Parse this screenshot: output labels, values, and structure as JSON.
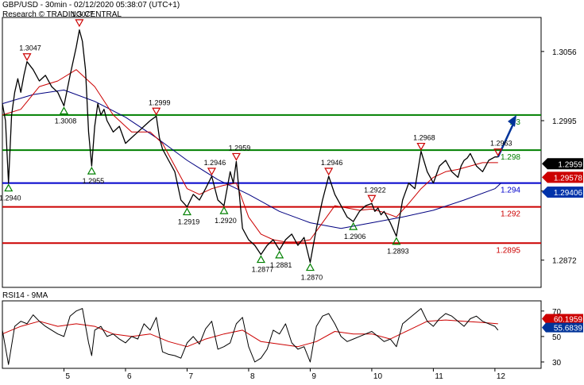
{
  "header": {
    "title_line": "GBP/USD - 30min - 02/12/2020 05:38:07 (UTC+1)",
    "subtitle_line": "Research © TRADING CENTRAL"
  },
  "colors": {
    "price": "#000000",
    "ma_fast": "#cc0000",
    "ma_slow": "#000080",
    "level_green": "#008000",
    "level_blue": "#0000cc",
    "level_red": "#cc0000",
    "arrow": "#003399",
    "marker_up": "#008000",
    "marker_down": "#cc0000",
    "rsi": "#000000",
    "rsi_ma": "#cc0000",
    "current_price_badge": "#000000",
    "ma_badge": "#cc0000",
    "pivot_badge": "#0033aa",
    "rsi_ma_badge": "#cc0000",
    "rsi_badge": "#003399"
  },
  "chart_data": {
    "type": "line",
    "title": "GBP/USD - 30min - 02/12/2020 05:38:07 (UTC+1)",
    "y_axis_ticks": [
      "1.3056",
      "1.2995",
      "1.2933",
      "1.2872"
    ],
    "x_axis_ticks": [
      "5",
      "6",
      "7",
      "8",
      "9",
      "10",
      "11",
      "12"
    ],
    "ylim": [
      1.2848,
      1.3086
    ],
    "x_range": [
      4.0,
      12.75
    ],
    "levels": [
      {
        "label": "1.3",
        "value": 1.3,
        "color_key": "level_green"
      },
      {
        "label": "1.298",
        "value": 1.2969,
        "color_key": "level_green"
      },
      {
        "label": "1.294",
        "value": 1.294,
        "color_key": "level_blue"
      },
      {
        "label": "1.292",
        "value": 1.2919,
        "color_key": "level_red"
      },
      {
        "label": "1.2895",
        "value": 1.2887,
        "color_key": "level_red"
      }
    ],
    "badges": [
      {
        "label": "1.2959",
        "value": 1.2957,
        "color_key": "current_price_badge"
      },
      {
        "label": "1.29578",
        "value": 1.2945,
        "color_key": "ma_badge"
      },
      {
        "label": "1.29406",
        "value": 1.2932,
        "color_key": "pivot_badge"
      }
    ],
    "price_series": {
      "name": "GBP/USD",
      "x": [
        4.0,
        4.05,
        4.1,
        4.15,
        4.2,
        4.25,
        4.3,
        4.35,
        4.4,
        4.5,
        4.6,
        4.7,
        4.8,
        4.9,
        5.0,
        5.1,
        5.2,
        5.25,
        5.3,
        5.35,
        5.4,
        5.45,
        5.5,
        5.55,
        5.6,
        5.65,
        5.7,
        5.8,
        5.9,
        6.0,
        6.1,
        6.2,
        6.3,
        6.4,
        6.5,
        6.55,
        6.6,
        6.7,
        6.8,
        6.9,
        7.0,
        7.1,
        7.2,
        7.3,
        7.4,
        7.5,
        7.6,
        7.65,
        7.7,
        7.75,
        7.8,
        7.9,
        8.0,
        8.1,
        8.2,
        8.3,
        8.4,
        8.5,
        8.6,
        8.7,
        8.8,
        8.9,
        9.0,
        9.1,
        9.2,
        9.3,
        9.4,
        9.5,
        9.6,
        9.7,
        9.8,
        9.9,
        10.0,
        10.05,
        10.1,
        10.15,
        10.2,
        10.3,
        10.4,
        10.5,
        10.6,
        10.7,
        10.8,
        10.9,
        11.0,
        11.1,
        11.2,
        11.3,
        11.4,
        11.45,
        11.5,
        11.55,
        11.6,
        11.7,
        11.8,
        11.9,
        12.0,
        12.05
      ],
      "values": [
        1.301,
        1.2995,
        1.294,
        1.3,
        1.302,
        1.3032,
        1.302,
        1.3035,
        1.3047,
        1.304,
        1.303,
        1.3035,
        1.3025,
        1.302,
        1.3008,
        1.3035,
        1.306,
        1.3075,
        1.3065,
        1.304,
        1.2985,
        1.2955,
        1.299,
        1.301,
        1.3,
        1.3005,
        1.2995,
        1.2985,
        1.299,
        1.2975,
        1.298,
        1.2985,
        1.299,
        1.2995,
        1.2999,
        1.298,
        1.297,
        1.296,
        1.295,
        1.2925,
        1.2919,
        1.293,
        1.2925,
        1.2935,
        1.2946,
        1.2925,
        1.292,
        1.2935,
        1.295,
        1.294,
        1.2959,
        1.29,
        1.289,
        1.2885,
        1.2877,
        1.2885,
        1.289,
        1.2881,
        1.289,
        1.2895,
        1.2885,
        1.2892,
        1.287,
        1.29,
        1.2925,
        1.2946,
        1.293,
        1.292,
        1.291,
        1.2906,
        1.2915,
        1.292,
        1.2922,
        1.2915,
        1.2918,
        1.2912,
        1.2915,
        1.2905,
        1.2893,
        1.2925,
        1.294,
        1.2935,
        1.2968,
        1.295,
        1.294,
        1.2955,
        1.296,
        1.295,
        1.2945,
        1.2955,
        1.296,
        1.2962,
        1.2966,
        1.2955,
        1.295,
        1.296,
        1.2963,
        1.2963
      ]
    },
    "ma_fast_series": {
      "x": [
        4.0,
        4.3,
        4.6,
        4.9,
        5.2,
        5.5,
        5.8,
        6.1,
        6.4,
        6.6,
        6.8,
        7.0,
        7.2,
        7.4,
        7.6,
        7.8,
        8.0,
        8.2,
        8.4,
        8.6,
        8.8,
        9.0,
        9.2,
        9.4,
        9.6,
        9.8,
        10.0,
        10.2,
        10.4,
        10.6,
        10.8,
        11.0,
        11.2,
        11.4,
        11.6,
        11.8,
        12.05
      ],
      "values": [
        1.3,
        1.3005,
        1.3025,
        1.303,
        1.304,
        1.3025,
        1.3,
        1.2985,
        1.2985,
        1.2975,
        1.2955,
        1.2935,
        1.293,
        1.2935,
        1.2938,
        1.294,
        1.291,
        1.2895,
        1.289,
        1.2888,
        1.2888,
        1.289,
        1.2905,
        1.292,
        1.2918,
        1.2916,
        1.2917,
        1.2914,
        1.291,
        1.2922,
        1.2935,
        1.2945,
        1.295,
        1.2952,
        1.2955,
        1.2958,
        1.2958
      ]
    },
    "ma_slow_series": {
      "x": [
        4.0,
        4.5,
        5.0,
        5.5,
        6.0,
        6.5,
        7.0,
        7.5,
        8.0,
        8.5,
        9.0,
        9.5,
        10.0,
        10.5,
        11.0,
        11.5,
        12.0,
        12.1
      ],
      "values": [
        1.301,
        1.3018,
        1.3022,
        1.3012,
        1.2998,
        1.298,
        1.296,
        1.2943,
        1.293,
        1.2915,
        1.2905,
        1.29,
        1.2905,
        1.291,
        1.2916,
        1.2925,
        1.2935,
        1.294
      ]
    },
    "forecast_arrow": {
      "from_x": 12.05,
      "from_y": 1.2963,
      "to_x": 12.35,
      "to_y": 1.3
    },
    "annotations_low": [
      {
        "label": "1.2940",
        "x": 4.1,
        "y": 1.294
      },
      {
        "label": "1.3008",
        "x": 5.0,
        "y": 1.3008
      },
      {
        "label": "1.2955",
        "x": 5.45,
        "y": 1.2955
      },
      {
        "label": "1.2919",
        "x": 7.0,
        "y": 1.2919
      },
      {
        "label": "1.2920",
        "x": 7.6,
        "y": 1.292
      },
      {
        "label": "1.2877",
        "x": 8.2,
        "y": 1.2877
      },
      {
        "label": "1.2881",
        "x": 8.5,
        "y": 1.2881
      },
      {
        "label": "1.2870",
        "x": 9.0,
        "y": 1.287
      },
      {
        "label": "1.2906",
        "x": 9.7,
        "y": 1.2906
      },
      {
        "label": "1.2893",
        "x": 10.4,
        "y": 1.2893
      }
    ],
    "annotations_high": [
      {
        "label": "1.3047",
        "x": 4.4,
        "y": 1.3047
      },
      {
        "label": "1.3077",
        "x": 5.25,
        "y": 1.3077
      },
      {
        "label": "1.2999",
        "x": 6.5,
        "y": 1.2999
      },
      {
        "label": "1.2946",
        "x": 7.4,
        "y": 1.2946
      },
      {
        "label": "1.2959",
        "x": 7.8,
        "y": 1.2959
      },
      {
        "label": "1.2946",
        "x": 9.3,
        "y": 1.2946
      },
      {
        "label": "1.2922",
        "x": 10.0,
        "y": 1.2922
      },
      {
        "label": "1.2968",
        "x": 10.8,
        "y": 1.2968
      },
      {
        "label": "1.2963",
        "x": 12.05,
        "y": 1.2963
      }
    ],
    "rsi_panel": {
      "title": "RSI14 - 9MA",
      "ylim": [
        25,
        78
      ],
      "y_axis_ticks": [
        70,
        50,
        30
      ],
      "badges": [
        {
          "label": "60.1959",
          "value": 64,
          "color_key": "rsi_ma_badge"
        },
        {
          "label": "55.6839",
          "value": 57,
          "color_key": "rsi_badge"
        }
      ],
      "rsi_series": {
        "x": [
          4.0,
          4.1,
          4.2,
          4.3,
          4.4,
          4.5,
          4.6,
          4.7,
          4.8,
          4.9,
          5.0,
          5.1,
          5.2,
          5.3,
          5.4,
          5.45,
          5.5,
          5.6,
          5.7,
          5.8,
          5.9,
          6.0,
          6.1,
          6.2,
          6.3,
          6.4,
          6.5,
          6.6,
          6.7,
          6.8,
          6.9,
          7.0,
          7.1,
          7.2,
          7.3,
          7.4,
          7.5,
          7.6,
          7.7,
          7.8,
          7.9,
          8.0,
          8.1,
          8.2,
          8.3,
          8.4,
          8.5,
          8.6,
          8.7,
          8.8,
          8.9,
          9.0,
          9.1,
          9.2,
          9.3,
          9.4,
          9.5,
          9.6,
          9.7,
          9.8,
          9.9,
          10.0,
          10.1,
          10.2,
          10.3,
          10.4,
          10.5,
          10.6,
          10.7,
          10.8,
          10.9,
          11.0,
          11.1,
          11.2,
          11.3,
          11.4,
          11.5,
          11.6,
          11.7,
          11.8,
          11.9,
          12.0,
          12.05
        ],
        "values": [
          55,
          28,
          58,
          62,
          60,
          67,
          62,
          58,
          55,
          52,
          50,
          66,
          70,
          72,
          45,
          35,
          55,
          58,
          50,
          52,
          48,
          45,
          50,
          48,
          60,
          55,
          65,
          38,
          36,
          35,
          33,
          45,
          50,
          44,
          56,
          62,
          40,
          42,
          45,
          60,
          65,
          42,
          30,
          33,
          40,
          55,
          52,
          60,
          45,
          40,
          42,
          30,
          58,
          66,
          68,
          60,
          50,
          46,
          48,
          50,
          52,
          54,
          50,
          46,
          48,
          42,
          60,
          64,
          68,
          72,
          62,
          58,
          64,
          68,
          66,
          62,
          58,
          64,
          66,
          62,
          60,
          58,
          55
        ]
      },
      "rsi_ma_series": {
        "x": [
          4.0,
          4.3,
          4.6,
          4.9,
          5.2,
          5.5,
          5.8,
          6.1,
          6.4,
          6.7,
          7.0,
          7.3,
          7.6,
          7.9,
          8.2,
          8.5,
          8.8,
          9.1,
          9.4,
          9.7,
          10.0,
          10.3,
          10.6,
          10.9,
          11.2,
          11.5,
          11.8,
          12.05
        ],
        "values": [
          52,
          58,
          62,
          58,
          60,
          58,
          52,
          50,
          52,
          46,
          42,
          48,
          52,
          55,
          46,
          44,
          42,
          46,
          54,
          52,
          52,
          48,
          55,
          62,
          63,
          62,
          61,
          60
        ]
      }
    }
  }
}
